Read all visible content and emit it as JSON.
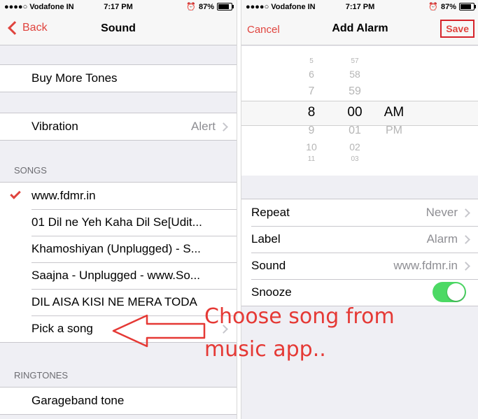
{
  "left": {
    "status": {
      "carrier": "●●●●○ Vodafone IN",
      "time": "7:17 PM",
      "battery": "87%",
      "battery_level": 0.87
    },
    "nav": {
      "back_label": "Back",
      "title": "Sound"
    },
    "buy_tones": "Buy More Tones",
    "vibration": {
      "label": "Vibration",
      "value": "Alert"
    },
    "songs_header": "SONGS",
    "songs": [
      "www.fdmr.in",
      "01 Dil ne Yeh Kaha Dil Se[Udit...",
      "Khamoshiyan (Unplugged) - S...",
      "Saajna - Unplugged - www.So...",
      "DIL AISA KISI NE MERA TODA",
      "Pick a song"
    ],
    "ringtones_header": "RINGTONES",
    "ringtones": [
      "Garageband tone"
    ]
  },
  "right": {
    "status": {
      "carrier": "●●●●○ Vodafone IN",
      "time": "7:17 PM",
      "battery": "87%",
      "battery_level": 0.87
    },
    "nav": {
      "cancel_label": "Cancel",
      "title": "Add Alarm",
      "save_label": "Save"
    },
    "picker": {
      "hours": [
        "5",
        "6",
        "7",
        "8",
        "9",
        "10",
        "11"
      ],
      "minutes": [
        "57",
        "58",
        "59",
        "00",
        "01",
        "02",
        "03"
      ],
      "ampm": [
        "AM",
        "PM"
      ],
      "selected": {
        "hour": "8",
        "minute": "00",
        "ampm": "AM"
      }
    },
    "rows": [
      {
        "label": "Repeat",
        "value": "Never"
      },
      {
        "label": "Label",
        "value": "Alarm"
      },
      {
        "label": "Sound",
        "value": "www.fdmr.in"
      },
      {
        "label": "Snooze",
        "toggle_on": true
      }
    ]
  },
  "annotation": {
    "line1": "Choose song from",
    "line2": "music app..",
    "color": "#e53935"
  }
}
